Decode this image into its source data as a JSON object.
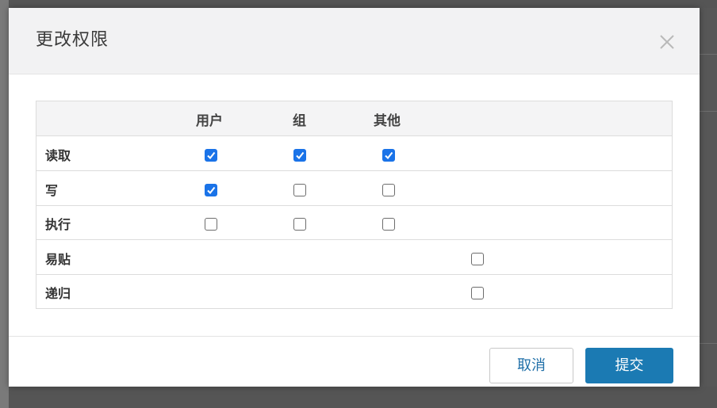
{
  "dialog": {
    "title": "更改权限",
    "close_icon": "close-icon"
  },
  "table": {
    "columns": [
      "用户",
      "组",
      "其他"
    ],
    "rows": [
      {
        "label": "读取",
        "user": true,
        "group": true,
        "other": true
      },
      {
        "label": "写",
        "user": true,
        "group": false,
        "other": false
      },
      {
        "label": "执行",
        "user": false,
        "group": false,
        "other": false
      },
      {
        "label": "易贴",
        "single": false
      },
      {
        "label": "递归",
        "single": false
      }
    ]
  },
  "footer": {
    "cancel_label": "取消",
    "submit_label": "提交"
  },
  "colors": {
    "accent": "#1b7ab3",
    "checkbox_on": "#1a73e8"
  }
}
